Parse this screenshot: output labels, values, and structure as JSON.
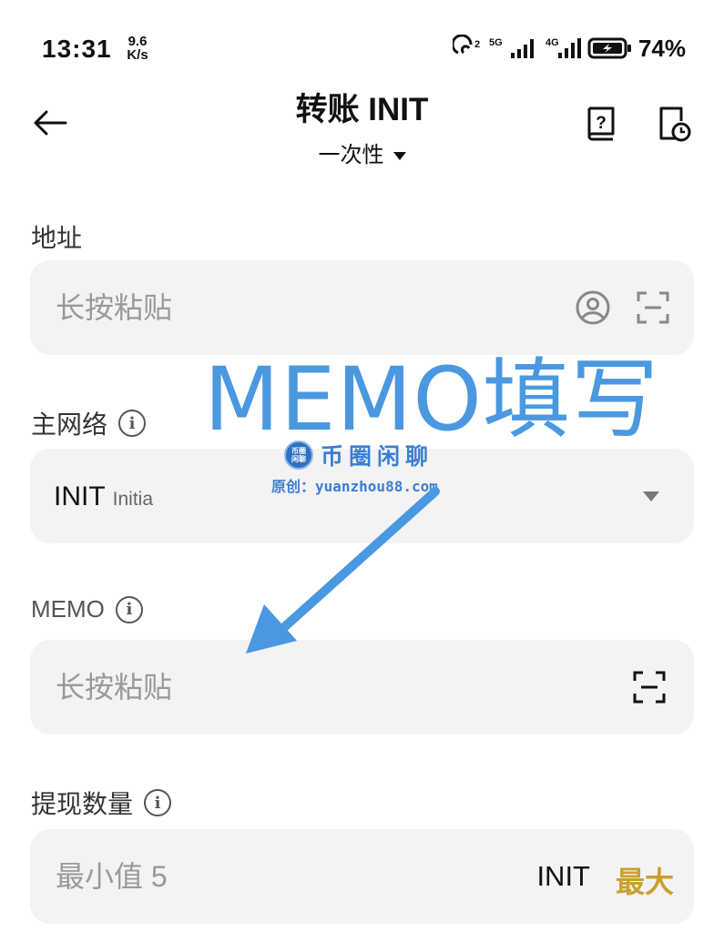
{
  "status_bar": {
    "time": "13:31",
    "net_speed_value": "9.6",
    "net_speed_unit": "K/s",
    "battery_percent": "74%",
    "sim1_label": "5G",
    "sim2_label": "4G"
  },
  "header": {
    "title": "转账 INIT",
    "subtitle": "一次性"
  },
  "address": {
    "label": "地址",
    "placeholder": "长按粘贴"
  },
  "network": {
    "label": "主网络",
    "value": "INIT",
    "sub_value": "Initia"
  },
  "memo": {
    "label": "MEMO",
    "placeholder": "长按粘贴"
  },
  "amount": {
    "label": "提现数量",
    "placeholder": "最小值 5",
    "unit": "INIT",
    "max_label": "最大"
  },
  "annotation": {
    "text": "MEMO填写",
    "watermark_logo": "币圈闲聊",
    "watermark_name": "币圈闲聊",
    "watermark_url": "原创：yuanzhou88.com"
  },
  "colors": {
    "accent_gold": "#c9a02c",
    "annotation_blue": "#4a98e0",
    "field_bg": "#f3f3f3"
  }
}
